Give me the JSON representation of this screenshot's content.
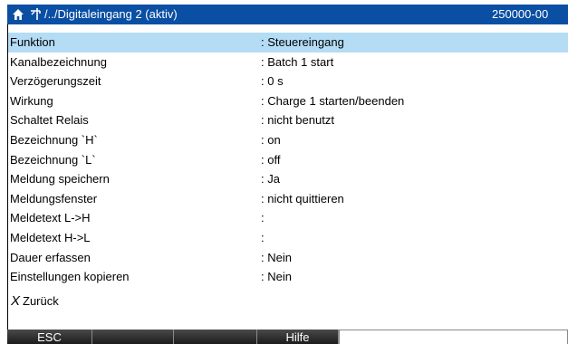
{
  "titlebar": {
    "path": "/../Digitaleingang 2 (aktiv)",
    "id": "250000-00",
    "home_icon": "home-icon",
    "path_icon": "wrench-icon"
  },
  "settings": [
    {
      "label": "Funktion",
      "value": ": Steuereingang"
    },
    {
      "label": "Kanalbezeichnung",
      "value": ": Batch 1 start"
    },
    {
      "label": "Verzögerungszeit",
      "value": ": 0 s"
    },
    {
      "label": "Wirkung",
      "value": ": Charge 1 starten/beenden"
    },
    {
      "label": "Schaltet Relais",
      "value": ": nicht benutzt"
    },
    {
      "label": "Bezeichnung `H`",
      "value": ": on"
    },
    {
      "label": "Bezeichnung `L`",
      "value": ": off"
    },
    {
      "label": "Meldung speichern",
      "value": ": Ja"
    },
    {
      "label": "Meldungsfenster",
      "value": ": nicht quittieren"
    },
    {
      "label": "Meldetext L->H",
      "value": ":"
    },
    {
      "label": "Meldetext H->L",
      "value": ":"
    },
    {
      "label": "Dauer erfassen",
      "value": ": Nein"
    },
    {
      "label": "Einstellungen kopieren",
      "value": ": Nein"
    }
  ],
  "back": {
    "icon": "x-icon",
    "icon_glyph": "X",
    "label": "Zurück"
  },
  "softkeys": [
    {
      "label": "ESC"
    },
    {
      "label": ""
    },
    {
      "label": ""
    },
    {
      "label": "Hilfe"
    },
    {
      "label": ""
    }
  ],
  "colors": {
    "titlebar": "#0a4fa3",
    "selected_row": "#b4dcf5",
    "softkey_bar": "#2a2a2a"
  }
}
